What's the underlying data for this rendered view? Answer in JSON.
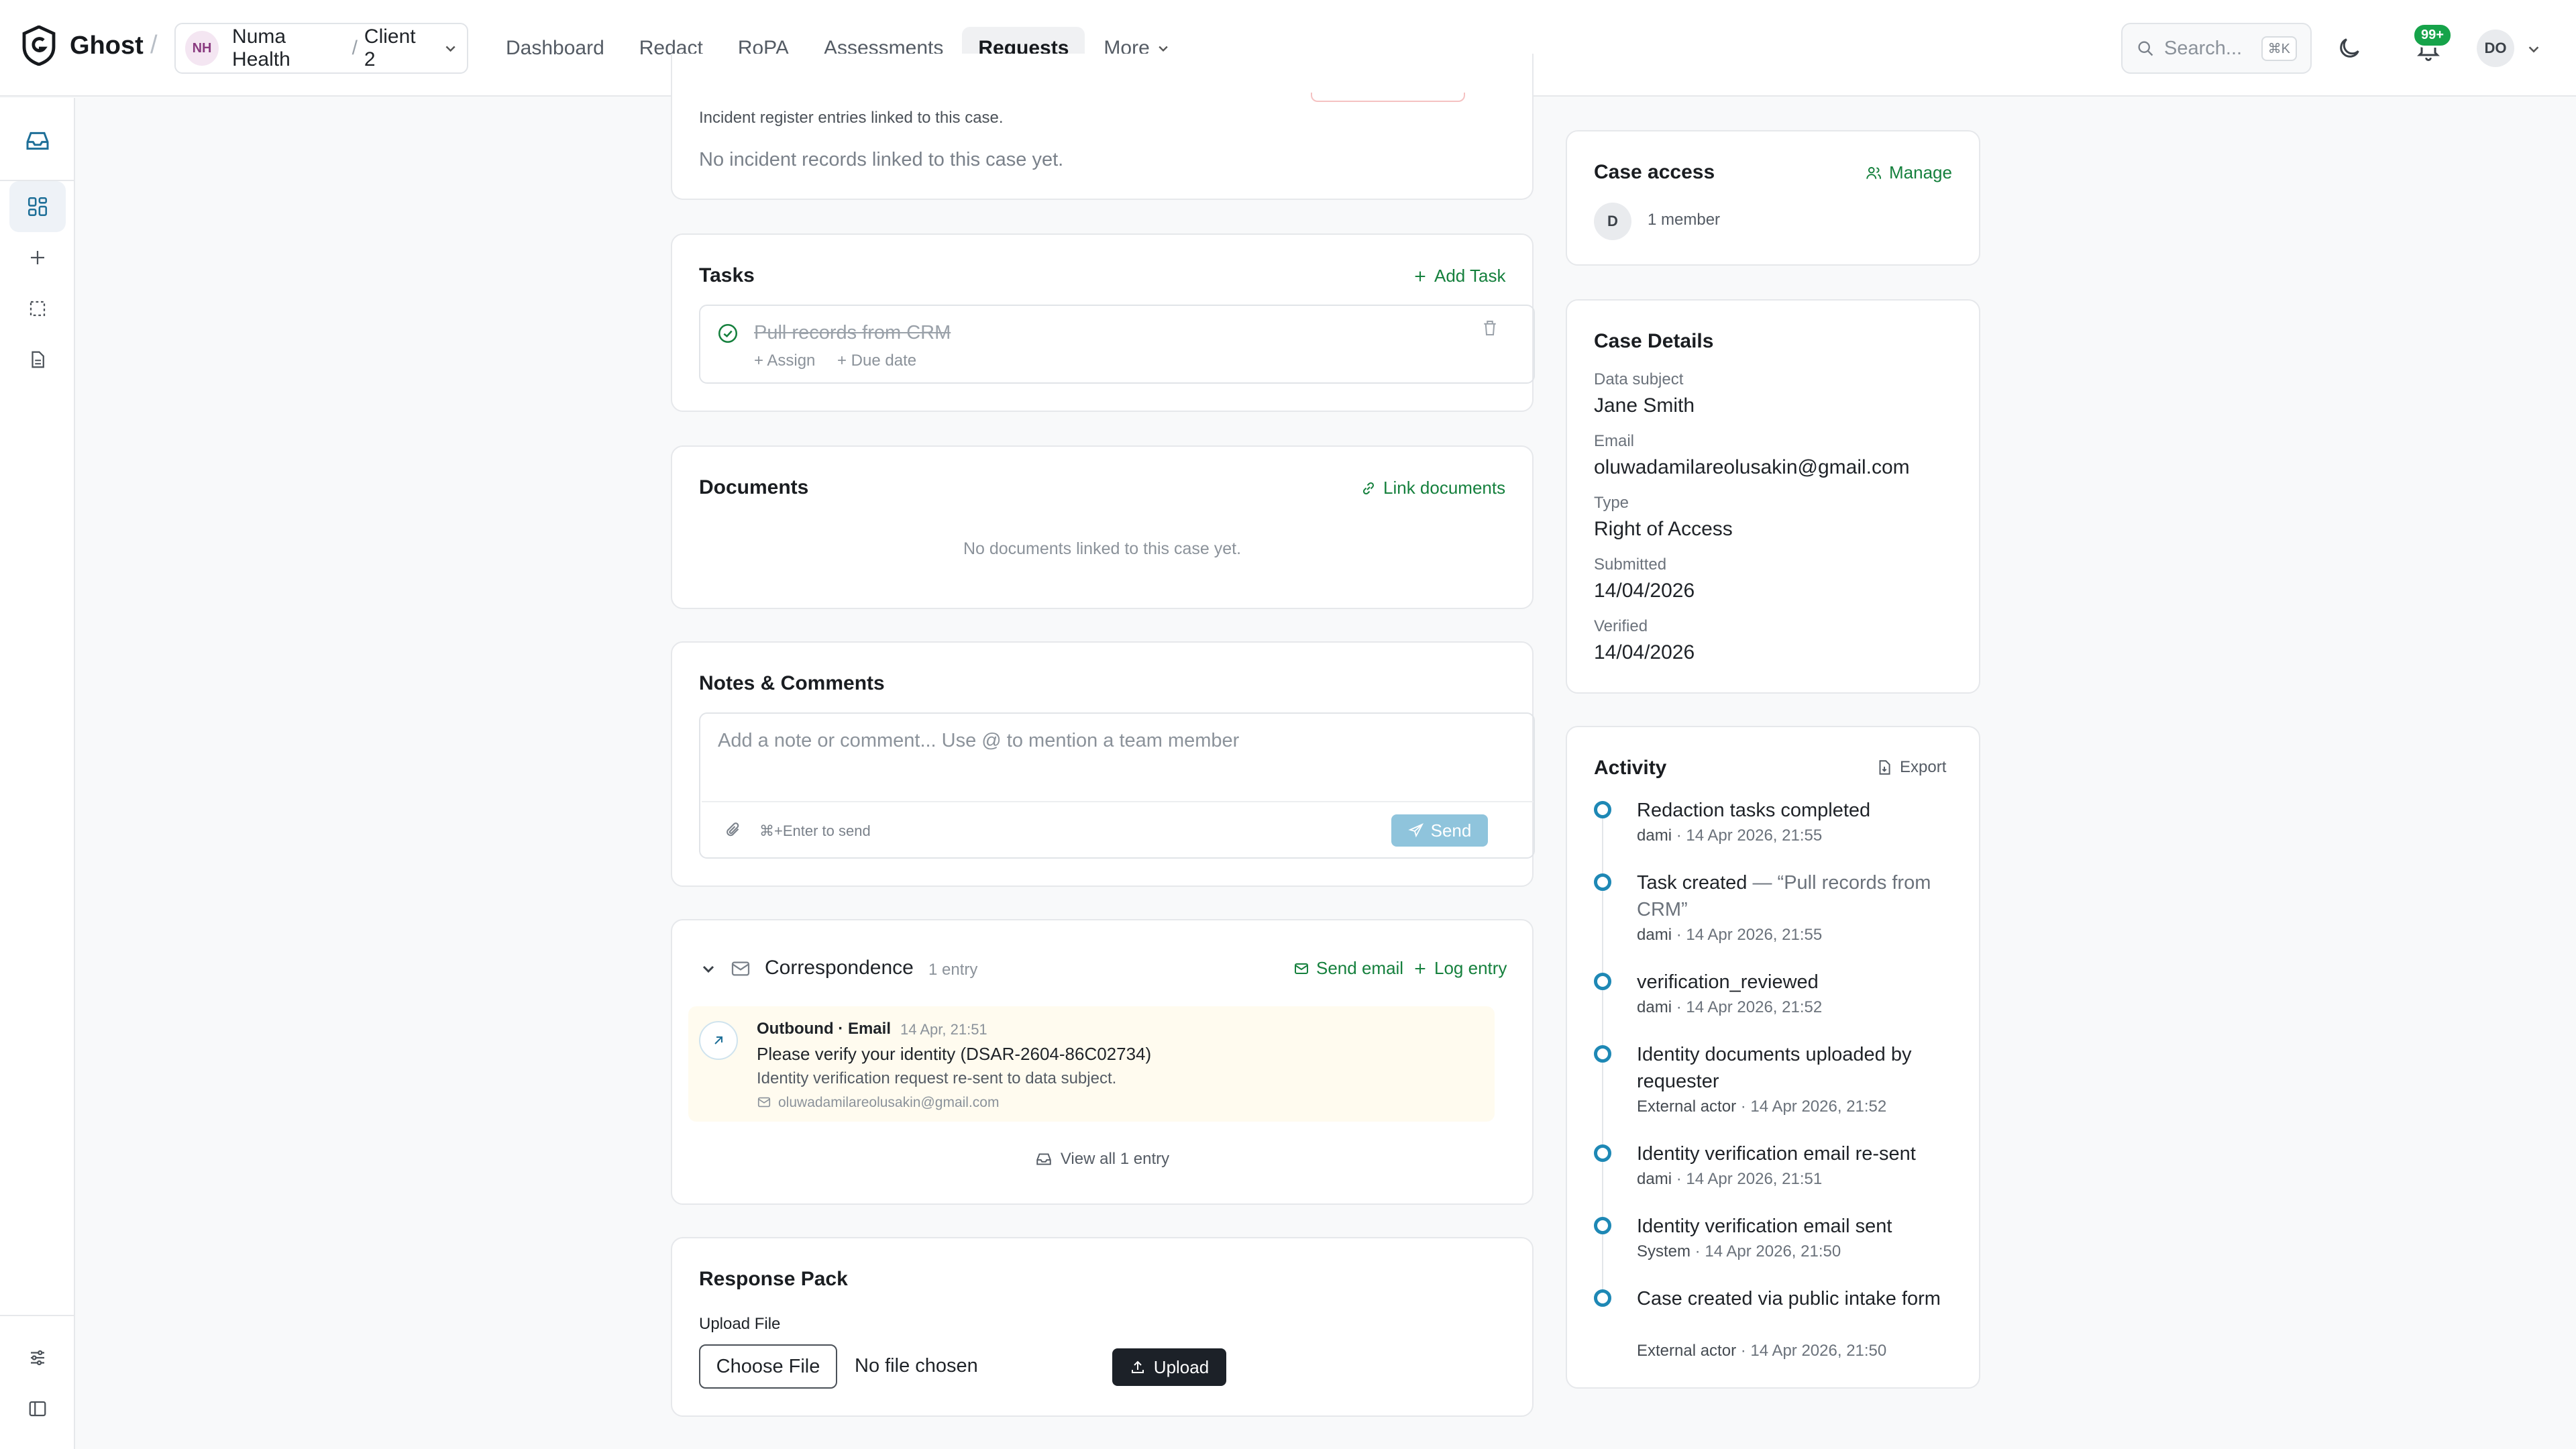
{
  "app": {
    "name": "Ghost",
    "org_initials": "NH",
    "org_name": "Numa Health",
    "org_client": "Client 2",
    "nav": [
      "Dashboard",
      "Redact",
      "RoPA",
      "Assessments",
      "Requests",
      "More"
    ],
    "active_nav": "Requests",
    "search_placeholder": "Search...",
    "search_shortcut": "⌘K",
    "notification_count": "99+",
    "user_initials": "DO"
  },
  "incidents": {
    "description": "Incident register entries linked to this case.",
    "empty": "No incident records linked to this case yet."
  },
  "tasks": {
    "title": "Tasks",
    "add_label": "Add Task",
    "items": [
      {
        "title": "Pull records from CRM",
        "assign": "+ Assign",
        "due": "+ Due date",
        "completed": true
      }
    ]
  },
  "documents": {
    "title": "Documents",
    "link_label": "Link documents",
    "empty": "No documents linked to this case yet."
  },
  "notes": {
    "title": "Notes & Comments",
    "placeholder": "Add a note or comment... Use @ to mention a team member",
    "hint": "⌘+Enter to send",
    "send_label": "Send"
  },
  "correspondence": {
    "title": "Correspondence",
    "count": "1 entry",
    "send_email_label": "Send email",
    "log_entry_label": "Log entry",
    "entries": [
      {
        "direction": "Outbound · Email",
        "time": "14 Apr, 21:51",
        "subject": "Please verify your identity (DSAR-2604-86C02734)",
        "body": "Identity verification request re-sent to data subject.",
        "email": "oluwadamilareolusakin@gmail.com"
      }
    ],
    "view_all_label": "View all 1 entry"
  },
  "response_pack": {
    "title": "Response Pack",
    "upload_label": "Upload File",
    "choose_label": "Choose File",
    "no_file": "No file chosen",
    "upload_button": "Upload"
  },
  "case_access": {
    "title": "Case access",
    "manage_label": "Manage",
    "member_initial": "D",
    "members": "1 member"
  },
  "case_details": {
    "title": "Case Details",
    "fields": [
      {
        "label": "Data subject",
        "value": "Jane Smith"
      },
      {
        "label": "Email",
        "value": "oluwadamilareolusakin@gmail.com"
      },
      {
        "label": "Type",
        "value": "Right of Access"
      },
      {
        "label": "Submitted",
        "value": "14/04/2026"
      },
      {
        "label": "Verified",
        "value": "14/04/2026"
      }
    ]
  },
  "activity": {
    "title": "Activity",
    "export_label": "Export",
    "items": [
      {
        "title": "Redaction tasks completed",
        "quote": "",
        "actor": "dami",
        "time": "14 Apr 2026, 21:55"
      },
      {
        "title": "Task created",
        "quote": "— “Pull records from CRM”",
        "actor": "dami",
        "time": "14 Apr 2026, 21:55"
      },
      {
        "title": "verification_reviewed",
        "quote": "",
        "actor": "dami",
        "time": "14 Apr 2026, 21:52"
      },
      {
        "title": "Identity documents uploaded by requester",
        "quote": "",
        "actor": "External actor",
        "time": "14 Apr 2026, 21:52"
      },
      {
        "title": "Identity verification email re-sent",
        "quote": "",
        "actor": "dami",
        "time": "14 Apr 2026, 21:51"
      },
      {
        "title": "Identity verification email sent",
        "quote": "",
        "actor": "System",
        "time": "14 Apr 2026, 21:50"
      },
      {
        "title": "Case created via public intake form",
        "quote": "",
        "actor": "External actor",
        "time": "14 Apr 2026, 21:50"
      }
    ]
  },
  "colors": {
    "accent_green": "#15803d",
    "activity_dot": "#1e88b5",
    "badge_green": "#16a34a",
    "send_button": "#8fc4dc",
    "upload_button": "#1c2128"
  }
}
